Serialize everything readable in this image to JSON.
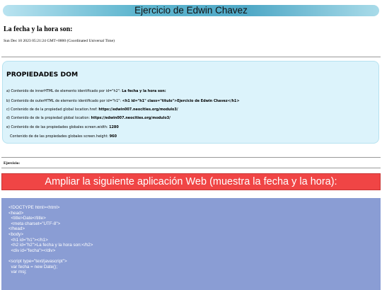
{
  "header": {
    "title": "Ejercicio de Edwin Chavez"
  },
  "subtitle": "La fecha y la hora son:",
  "fecha": "Sun Dec 10 2023 05:21:24 GMT+0000 (Coordinated Universal Time)",
  "dom": {
    "title": "PROPIEDADES DOM",
    "lines": [
      {
        "label": "a) Contenido de innerHTML de elemento identificado por id=\"h2\": ",
        "value": "La fecha y la hora son:"
      },
      {
        "label": "b) Contenido de outerHTML de elemento identificado por id=\"h1\": ",
        "value": "<h1 id=\"h1\" class=\"titulo\">Ejercicio de Edwin Chavez</h1>"
      },
      {
        "label": "c) Contenido de de la propiedad global location.href: ",
        "value": "https://edwin007.neocities.org/modulo3/"
      },
      {
        "label": "d) Contenido de de la propiedad global location: ",
        "value": "https://edwin007.neocities.org/modulo3/"
      },
      {
        "label": "e) Contenido de de las propiedades globales screen.width: ",
        "value": "1280"
      },
      {
        "label": "Contenido de de las propiedades globales screen.height: ",
        "value": "960"
      }
    ]
  },
  "ejercicio_label": "Ejercicio:",
  "banner_text": "Ampliar la siguiente aplicación Web (muestra la fecha y la hora):",
  "code_lines": [
    "<!DOCTYPE html><html>",
    "<head>",
    "  <title>Date</title>",
    "  <meta charset=\"UTF-8\">",
    "</head>",
    "<body>",
    "  <h1 id=\"h1\"></h1>",
    "  <h2 id=\"h2\">La fecha y la hora son:</h2>",
    "  <div id=\"fecha\"></div>",
    "",
    "<script type=\"text/javascript\">",
    "  var fecha = new Date();",
    "  var msj;"
  ]
}
